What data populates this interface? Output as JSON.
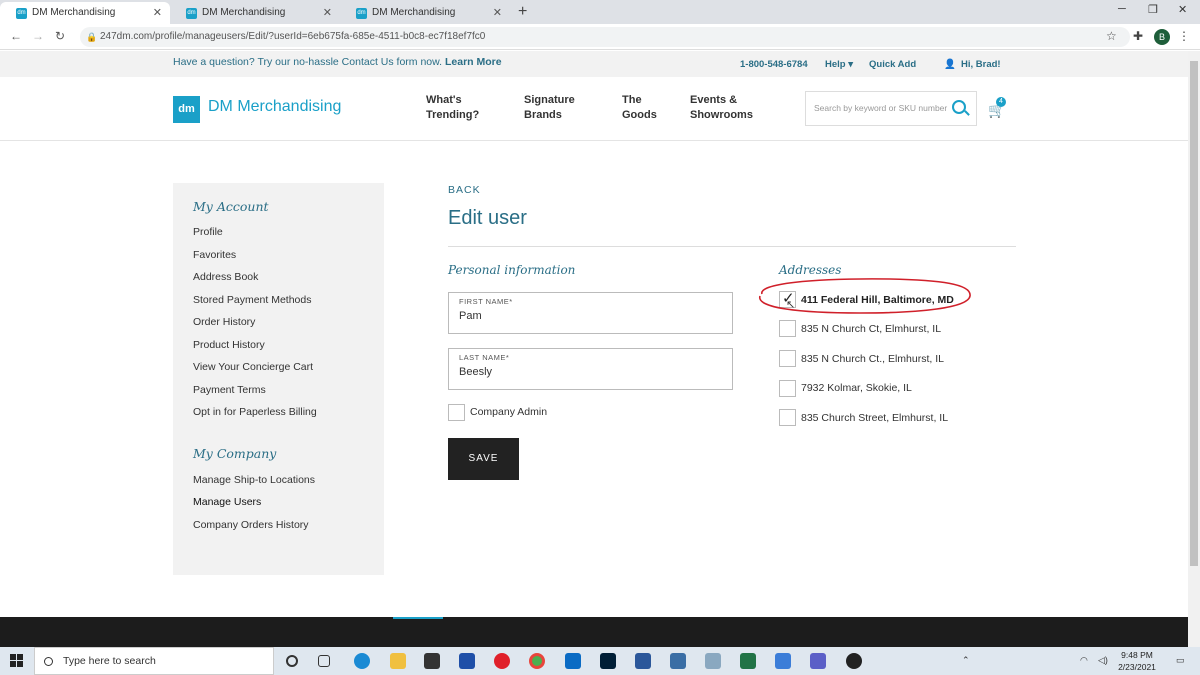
{
  "browser": {
    "tabs": [
      {
        "title": "DM Merchandising"
      },
      {
        "title": "DM Merchandising"
      },
      {
        "title": "DM Merchandising"
      }
    ],
    "url": "247dm.com/profile/manageusers/Edit/?userId=6eb675fa-685e-4511-b0c8-ec7f18ef7fc0",
    "profile_initial": "B"
  },
  "topbar": {
    "question": "Have a question? Try our no-hassle Contact Us form now.",
    "learn_more": "Learn More",
    "phone": "1-800-548-6784",
    "help": "Help",
    "quick_add": "Quick Add",
    "greeting": "Hi, Brad!"
  },
  "header": {
    "logo_mark": "dm",
    "logo_text": "DM Merchandising",
    "nav": [
      {
        "line1": "What's",
        "line2": "Trending?"
      },
      {
        "line1": "Signature",
        "line2": "Brands"
      },
      {
        "line1": "The",
        "line2": "Goods"
      },
      {
        "line1": "Events &",
        "line2": "Showrooms"
      }
    ],
    "search_placeholder": "Search by keyword or SKU number",
    "cart_count": "4"
  },
  "sidebar": {
    "account_heading": "My Account",
    "account_items": [
      "Profile",
      "Favorites",
      "Address Book",
      "Stored Payment Methods",
      "Order History",
      "Product History",
      "View Your Concierge Cart",
      "Payment Terms",
      "Opt in for Paperless Billing"
    ],
    "company_heading": "My Company",
    "company_items": [
      "Manage Ship-to Locations",
      "Manage Users",
      "Company Orders History"
    ]
  },
  "main": {
    "back": "BACK",
    "title": "Edit user",
    "personal_heading": "Personal information",
    "first_name_label": "FIRST NAME*",
    "first_name": "Pam",
    "last_name_label": "LAST NAME*",
    "last_name": "Beesly",
    "company_admin": "Company Admin",
    "save": "SAVE",
    "addresses_heading": "Addresses",
    "addresses": [
      {
        "label": "411 Federal Hill, Baltimore, MD",
        "checked": true
      },
      {
        "label": "835 N Church Ct, Elmhurst, IL",
        "checked": false
      },
      {
        "label": "835 N Church Ct., Elmhurst, IL",
        "checked": false
      },
      {
        "label": "7932 Kolmar, Skokie, IL",
        "checked": false
      },
      {
        "label": "835 Church Street, Elmhurst, IL",
        "checked": false
      }
    ]
  },
  "taskbar": {
    "search_placeholder": "Type here to search",
    "time": "9:48 PM",
    "date": "2/23/2021"
  },
  "colors": {
    "accent": "#1aa0c8",
    "link": "#2a6e86",
    "annotation": "#d0202a"
  }
}
